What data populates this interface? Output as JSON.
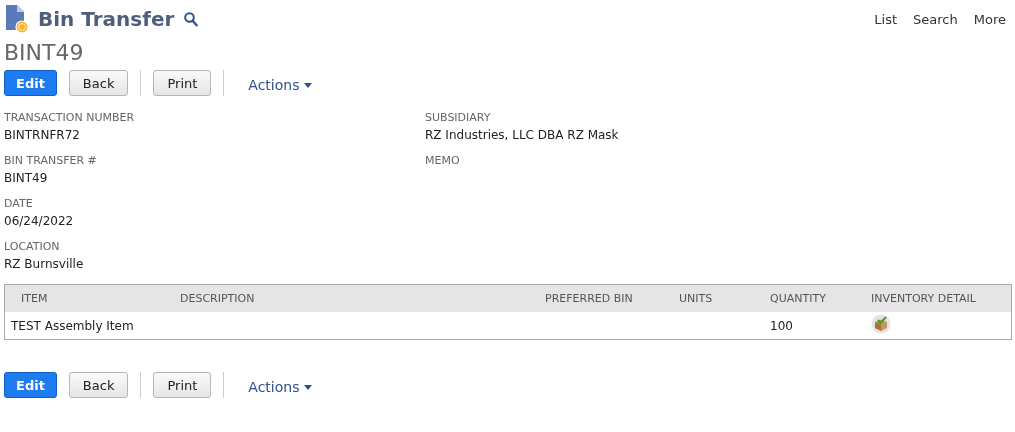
{
  "header": {
    "title": "Bin Transfer",
    "nav": [
      "List",
      "Search",
      "More"
    ]
  },
  "record_id": "BINT49",
  "top_buttons": [
    {
      "label": "Edit",
      "kind": "primary"
    },
    {
      "label": "Back",
      "kind": "secondary"
    },
    {
      "label": "Print",
      "kind": "secondary"
    },
    {
      "label": "Actions",
      "kind": "menu"
    }
  ],
  "fields_left": [
    {
      "label": "TRANSACTION NUMBER",
      "value": "BINTRNFR72"
    },
    {
      "label": "BIN TRANSFER #",
      "value": "BINT49"
    },
    {
      "label": "DATE",
      "value": "06/24/2022"
    },
    {
      "label": "LOCATION",
      "value": "RZ Burnsville"
    }
  ],
  "fields_right": [
    {
      "label": "SUBSIDIARY",
      "value": "RZ Industries, LLC DBA RZ Mask"
    },
    {
      "label": "MEMO"
    }
  ],
  "table": {
    "columns": [
      "ITEM",
      "DESCRIPTION",
      "PREFERRED BIN",
      "UNITS",
      "QUANTITY",
      "INVENTORY DETAIL"
    ],
    "rows": [
      {
        "item": "TEST Assembly Item",
        "quantity": "100",
        "inventory_detail": true
      }
    ]
  },
  "bottom_buttons": [
    {
      "label": "Edit",
      "kind": "primary"
    },
    {
      "label": "Back",
      "kind": "secondary"
    },
    {
      "label": "Print",
      "kind": "secondary"
    },
    {
      "label": "Actions",
      "kind": "menu"
    }
  ]
}
